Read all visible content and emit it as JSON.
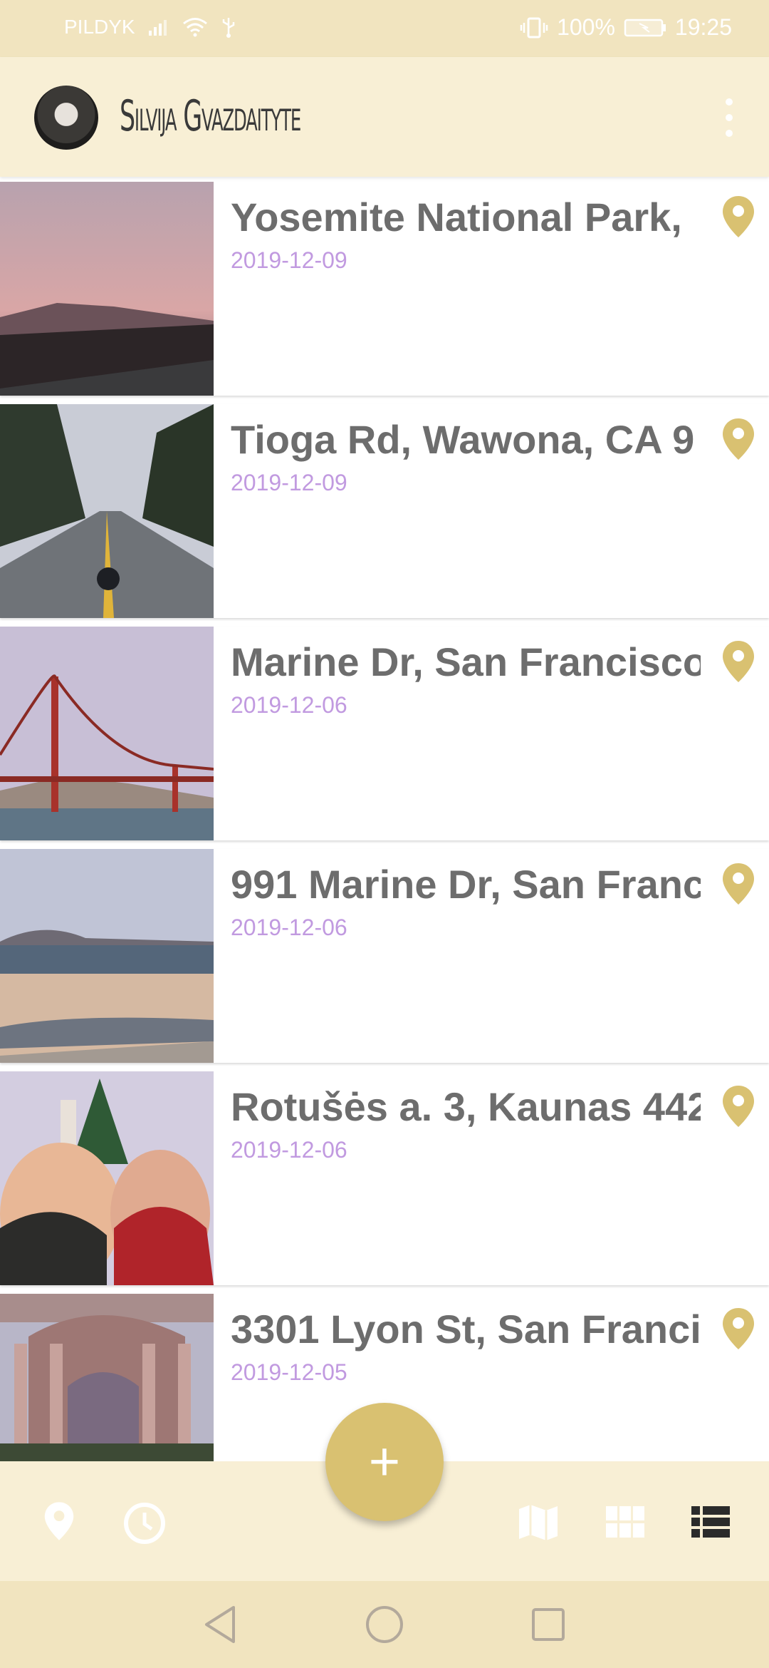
{
  "status_bar": {
    "carrier": "PILDYK",
    "battery": "100%",
    "time": "19:25"
  },
  "user": {
    "name": "Silvija Gvazdaityte"
  },
  "entries": [
    {
      "title": "Yosemite National Park,",
      "date": "2019-12-09"
    },
    {
      "title": "Tioga Rd, Wawona, CA 9",
      "date": "2019-12-09"
    },
    {
      "title": "Marine Dr, San Francisco",
      "date": "2019-12-06"
    },
    {
      "title": "991 Marine Dr, San Franc",
      "date": "2019-12-06"
    },
    {
      "title": "Rotušės a. 3, Kaunas 442",
      "date": "2019-12-06"
    },
    {
      "title": "3301 Lyon St, San Franci",
      "date": "2019-12-05"
    }
  ],
  "fab": {
    "label": "+"
  },
  "colors": {
    "accent": "#d9c171",
    "date": "#c19ae0",
    "bar": "#f8efd5",
    "status": "#f1e4bf"
  },
  "icons": {
    "bottom_left": [
      "location-pin-icon",
      "clock-icon"
    ],
    "bottom_right": [
      "map-icon",
      "grid-icon",
      "list-icon"
    ],
    "system": [
      "back-icon",
      "home-icon",
      "recents-icon"
    ]
  }
}
